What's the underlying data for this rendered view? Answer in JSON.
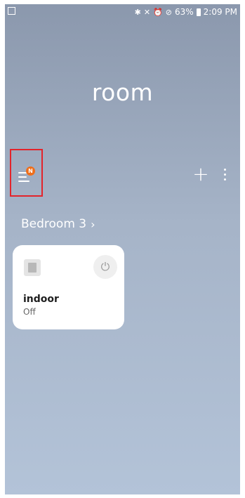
{
  "status_bar": {
    "battery": "63%",
    "time": "2:09 PM",
    "icons": [
      "image-notification-icon",
      "bluetooth-icon",
      "mute-icon",
      "alarm-icon",
      "do-not-disturb-icon",
      "battery-icon"
    ]
  },
  "header": {
    "title": "room",
    "menu_badge": "N"
  },
  "room": {
    "name": "Bedroom 3"
  },
  "device": {
    "name": "indoor",
    "state": "Off"
  },
  "colors": {
    "badge": "#ee6f1c",
    "highlight": "#e3242b",
    "background_top": "#8b98ad",
    "background_bottom": "#b3c3d8"
  }
}
